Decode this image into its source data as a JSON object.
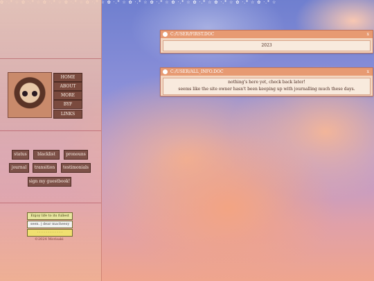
{
  "top_strip": {
    "text": "✿ ·.* ☆ ✿ ·.* ☆ ✿ ·.* ☆ ✿ ·.* ☆ ✿ ·.* ☆ ✿ ·.* ☆ ✿ ·.* ☆ ✿ ·.* ☆ ✿ ·.* ☆ ✿ ·.* ☆ ✿ ·.* ☆ ✿ ·.* ☆ ✿ ·.* ☆"
  },
  "nav": {
    "items": [
      "HOME",
      "ABOUT",
      "MORE",
      "BYF",
      "LINKS"
    ]
  },
  "tags": {
    "status": "status",
    "blacklist": "blacklist",
    "pronouns": "pronouns",
    "journal": "journal",
    "transition": "transition",
    "testimonials": "testimonials",
    "guestbook": "sign my guestbook!"
  },
  "badges": [
    "Enjoy life to its fullest",
    "seen. | dear macheesy",
    "· · · · · · · · · · · ·"
  ],
  "copyright": "©2024 Morisaki",
  "windows": {
    "first": {
      "title": "C:/USER/FIRST.DOC",
      "close": "x",
      "body": "2023"
    },
    "second": {
      "title": "C:/USER/ALL_INFO.DOC",
      "close": "x",
      "line1": "nothing's here yet, check back later!",
      "line2": "seems like the site owner hasn't been keeping up with journalling much these days."
    }
  }
}
